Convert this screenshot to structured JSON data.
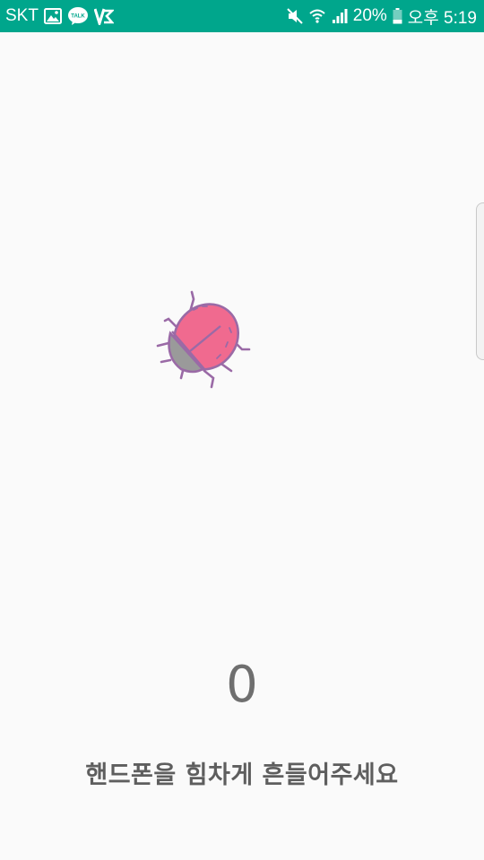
{
  "status_bar": {
    "carrier": "SKT",
    "battery": "20%",
    "time": "오후 5:19",
    "talk_badge": "TALK",
    "left_icons": [
      "gallery-icon",
      "kakaotalk-icon",
      "v3-icon"
    ],
    "right_icons": [
      "mute-icon",
      "wifi-icon",
      "signal-icon",
      "battery-icon"
    ]
  },
  "main": {
    "bug_icon": "ladybug-icon",
    "shake_count": "0",
    "instruction": "핸드폰을 힘차게 흔들어주세요"
  },
  "colors": {
    "status_bar": "#00a68c",
    "background": "#fafafa",
    "bug_body": "#f06a8f",
    "bug_head": "#9a9a9a",
    "bug_outline": "#9a6aa6",
    "text": "#666666"
  }
}
